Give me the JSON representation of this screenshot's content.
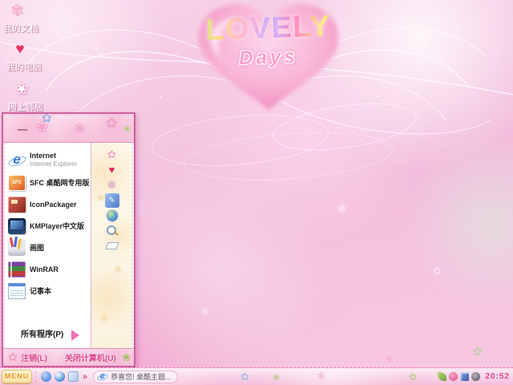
{
  "wallpaper": {
    "title": "LOVELY",
    "subtitle": "Days"
  },
  "desktop": {
    "icons": [
      {
        "label": "我的文档",
        "icon": "my-documents-icon"
      },
      {
        "label": "我的电脑",
        "icon": "my-computer-icon"
      },
      {
        "label": "网上邻居",
        "icon": "network-places-icon"
      }
    ]
  },
  "start_menu": {
    "username": "—",
    "items": [
      {
        "label": "Internet",
        "sublabel": "Internet Explorer",
        "icon": "internet-explorer-icon"
      },
      {
        "label": "SFC 桌酷网专用版",
        "icon": "sfc-icon"
      },
      {
        "label": "IconPackager",
        "icon": "iconpackager-icon"
      },
      {
        "label": "KMPlayer中文版",
        "icon": "kmplayer-icon"
      },
      {
        "label": "画图",
        "icon": "paint-icon"
      },
      {
        "label": "WinRAR",
        "icon": "winrar-icon"
      },
      {
        "label": "记事本",
        "icon": "notepad-icon"
      }
    ],
    "all_programs_label": "所有程序(P)",
    "right_icons": [
      "documents-icon",
      "favorites-heart-icon",
      "recent-documents-icon",
      "control-panel-icon",
      "network-globe-icon",
      "search-icon",
      "run-icon"
    ],
    "logoff_label": "注销(L)",
    "shutdown_label": "关闭计算机(U)"
  },
  "taskbar": {
    "start_button_label": "MENU",
    "quick_launch": [
      "internet-explorer-icon",
      "media-player-icon",
      "show-desktop-icon"
    ],
    "chevron": "»",
    "window_button": {
      "label": "恭喜您! 桌酷主题...",
      "icon": "internet-explorer-icon"
    },
    "tray_icons": [
      "leaf-icon",
      "theme-icon",
      "network-icon",
      "volume-icon"
    ],
    "clock": "20:52"
  },
  "colors": {
    "accent_pink": "#d6479f",
    "menu_border": "#cf5f9b",
    "taskbar_bg": "#f5bfda",
    "start_button_text": "#e8951e",
    "clock_text": "#d6478f"
  }
}
